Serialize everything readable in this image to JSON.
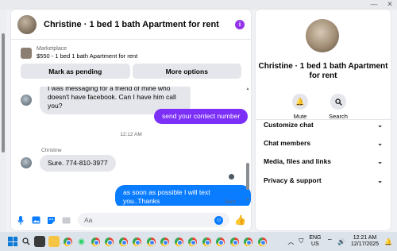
{
  "chat": {
    "title": "Christine · 1 bed 1 bath Apartment for rent",
    "info_icon": "i",
    "marketplace": {
      "label": "Marketplace",
      "listing": "$550 - 1 bed 1 bath Apartment for rent",
      "button_pending": "Mark as pending",
      "button_more": "More options"
    },
    "messages": {
      "incoming_1": "I was messaging for a friend of mine who doesn't have facebook. Can I have him call you?",
      "outgoing_1": "send your contect number",
      "timestamp": "12:12 AM",
      "sender": "Christine",
      "incoming_2": "Sure. 774-810-3977",
      "outgoing_2": "as soon as possible I will text you..Thanks",
      "sent_status": "Sent"
    },
    "composer": {
      "placeholder": "Aa"
    }
  },
  "info": {
    "name": "Christine · 1 bed 1 bath Apartment for rent",
    "mute_label": "Mute",
    "search_label": "Search",
    "menu": [
      "Customize chat",
      "Chat members",
      "Media, files and links",
      "Privacy & support"
    ]
  },
  "taskbar": {
    "language": "ENG",
    "region": "US",
    "time": "12:21 AM",
    "date": "12/17/2025"
  },
  "colors": {
    "accent_purple": "#7b2ff7",
    "accent_blue": "#0a7cff",
    "bubble_incoming": "#e4e6eb"
  }
}
